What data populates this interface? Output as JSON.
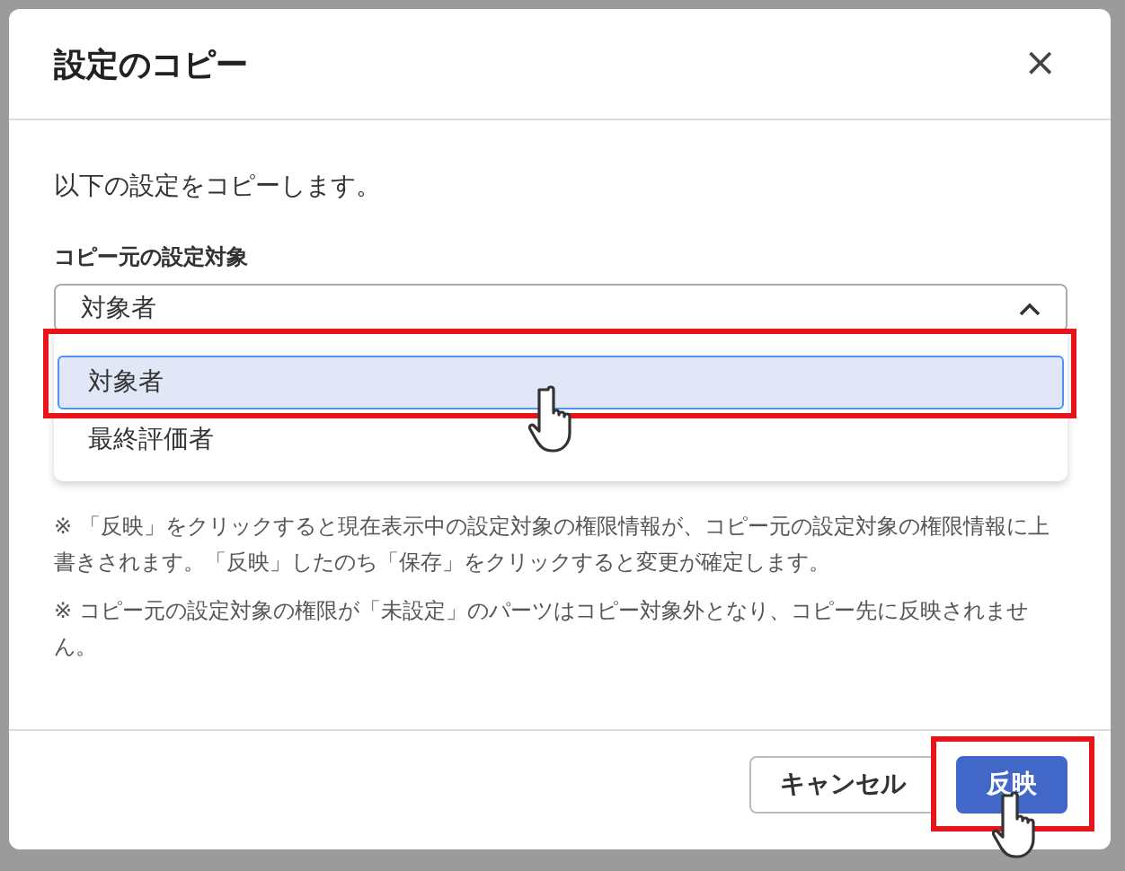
{
  "dialog": {
    "title": "設定のコピー",
    "close": "×",
    "intro": "以下の設定をコピーします。",
    "field": {
      "label": "コピー元の設定対象",
      "value": "対象者",
      "expanded": true,
      "options": [
        {
          "label": "対象者",
          "selected": true,
          "highlighted": true,
          "pointer": true
        },
        {
          "label": "最終評価者",
          "selected": false,
          "highlighted": false,
          "pointer": false
        }
      ]
    },
    "notes": [
      {
        "mark": "※",
        "text": "「反映」をクリックすると現在表示中の設定対象の権限情報が、コピー元の設定対象の権限情報に上書きされます。「反映」したのち「保存」をクリックすると変更が確定します。"
      },
      {
        "mark": "※",
        "text": "コピー元の設定対象の権限が「未設定」のパーツはコピー対象外となり、コピー先に反映されません。"
      }
    ],
    "buttons": [
      {
        "label": "キャンセル",
        "kind": "secondary",
        "highlighted": false,
        "pointer": false
      },
      {
        "label": "反映",
        "kind": "primary",
        "highlighted": true,
        "pointer": true
      }
    ]
  }
}
